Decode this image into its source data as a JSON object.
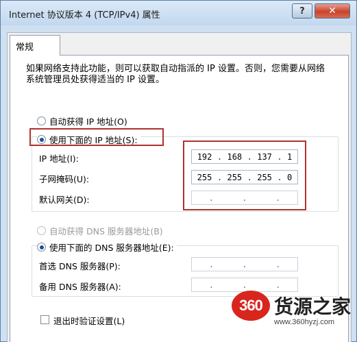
{
  "window": {
    "title": "Internet 协议版本 4 (TCP/IPv4) 属性",
    "help_label": "?",
    "close_label": "✕"
  },
  "tabs": [
    {
      "label": "常规"
    }
  ],
  "description": "如果网络支持此功能，则可以获取自动指派的 IP 设置。否则，您需要从网络系统管理员处获得适当的 IP 设置。",
  "ip_section": {
    "auto_label": "自动获得 IP 地址(O)",
    "manual_label": "使用下面的 IP 地址(S):",
    "selected": "manual",
    "fields": [
      {
        "label": "IP 地址(I):",
        "octets": [
          "192",
          "168",
          "137",
          "1"
        ]
      },
      {
        "label": "子网掩码(U):",
        "octets": [
          "255",
          "255",
          "255",
          "0"
        ]
      },
      {
        "label": "默认网关(D):",
        "octets": [
          "",
          "",
          "",
          ""
        ]
      }
    ]
  },
  "dns_section": {
    "auto_label": "自动获得 DNS 服务器地址(B)",
    "manual_label": "使用下面的 DNS 服务器地址(E):",
    "selected": "manual",
    "fields": [
      {
        "label": "首选 DNS 服务器(P):",
        "octets": [
          "",
          "",
          "",
          ""
        ]
      },
      {
        "label": "备用 DNS 服务器(A):",
        "octets": [
          "",
          "",
          "",
          ""
        ]
      }
    ]
  },
  "validate_on_exit": {
    "label": "退出时验证设置(L)",
    "checked": false
  },
  "watermark": {
    "badge": "360",
    "brand": "货源之家",
    "url": "www.360hyzj.com"
  },
  "colors": {
    "highlight": "#b0312c",
    "title_bar": "#c2d8ef",
    "close_button": "#c8432b"
  }
}
